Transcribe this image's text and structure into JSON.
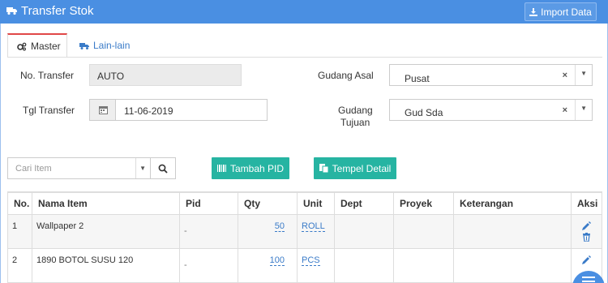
{
  "header": {
    "title": "Transfer Stok",
    "import_label": "Import Data"
  },
  "tabs": [
    {
      "label": "Master",
      "active": true
    },
    {
      "label": "Lain-lain",
      "active": false
    }
  ],
  "form": {
    "no_transfer_label": "No. Transfer",
    "no_transfer_value": "AUTO",
    "tgl_transfer_label": "Tgl Transfer",
    "tgl_transfer_value": "11-06-2019",
    "gudang_asal_label": "Gudang Asal",
    "gudang_asal_value": "Pusat",
    "gudang_tujuan_label_1": "Gudang",
    "gudang_tujuan_label_2": "Tujuan",
    "gudang_tujuan_value": "Gud Sda",
    "clear_symbol": "×",
    "caret_symbol": "▼"
  },
  "toolbar": {
    "search_placeholder": "Cari Item",
    "tambah_pid_label": "Tambah PID",
    "tempel_detail_label": "Tempel Detail"
  },
  "table": {
    "headers": [
      "No.",
      "Nama Item",
      "Pid",
      "Qty",
      "Unit",
      "Dept",
      "Proyek",
      "Keterangan",
      "Aksi"
    ],
    "rows": [
      {
        "no": "1",
        "nama": "Wallpaper 2",
        "pid": "-",
        "qty": "50",
        "unit": "ROLL"
      },
      {
        "no": "2",
        "nama": "1890 BOTOL SUSU 120",
        "pid": "-",
        "qty": "100",
        "unit": "PCS"
      }
    ]
  },
  "colors": {
    "header_bg": "#4a8fe2",
    "teal_button": "#26b4a2",
    "link": "#3a7bc8",
    "active_tab_border": "#e04848"
  }
}
